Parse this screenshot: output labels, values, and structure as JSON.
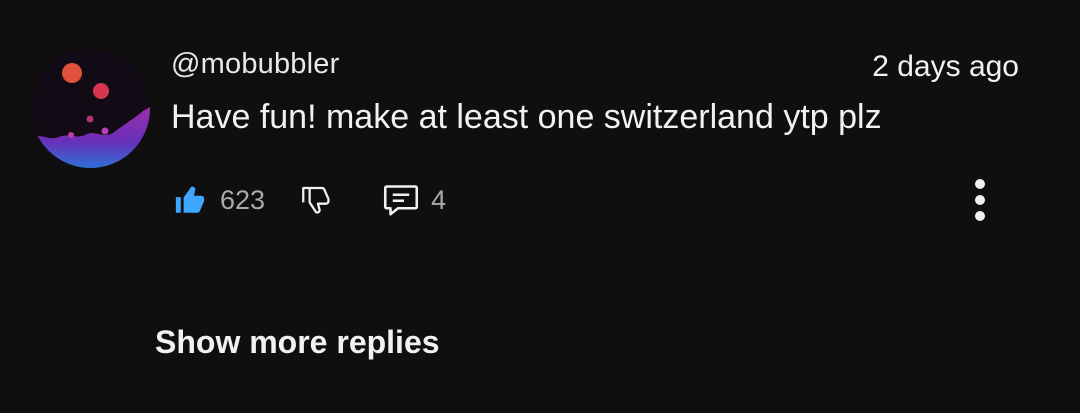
{
  "comment": {
    "author": "@mobubbler",
    "timestamp": "2 days ago",
    "text": "Have fun! make at least one switzerland ytp plz",
    "like_count": "623",
    "reply_count": "4",
    "avatar_icon": "avatar-image",
    "like_icon": "thumbs-up-icon",
    "dislike_icon": "thumbs-down-icon",
    "reply_icon": "comment-bubble-icon",
    "more_icon": "more-vertical-icon"
  },
  "replies": {
    "show_more_label": "Show more replies"
  },
  "colors": {
    "background": "#0f0f0f",
    "like_active": "#3ea6ff",
    "secondary_text": "#aaaaaa",
    "primary_text": "#f1f1f1"
  }
}
